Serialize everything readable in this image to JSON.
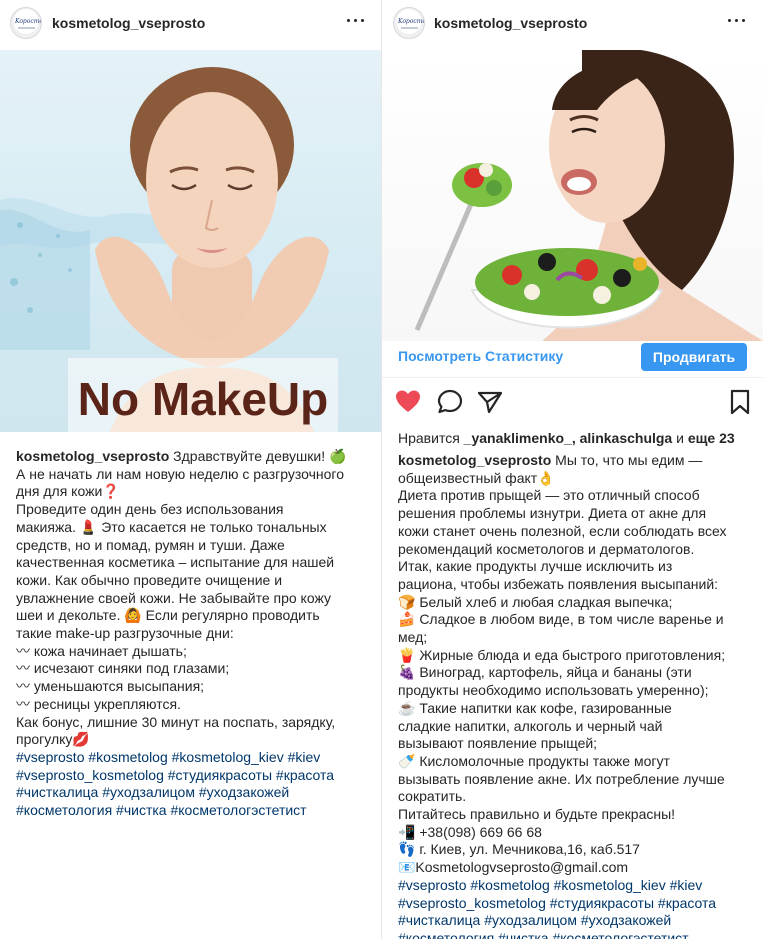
{
  "colors": {
    "link": "#3897f0",
    "hashtag": "#00376b",
    "heart": "#ed4956",
    "text": "#262626"
  },
  "left_post": {
    "username": "kosmetolog_vseprosto",
    "avatar_text": "Koросто",
    "image_overlay_text": "No MakeUp",
    "caption": {
      "intro": "Здравствуйте девушки! 🍏",
      "lines": [
        "А не начать ли нам новую неделю с разгрузочного",
        "дня для кожи❓",
        "Проведите один день без использования",
        "макияжа. 💄 Это касается не только тональных",
        "средств, но и помад, румян и туши. Даже",
        "качественная косметика – испытание для нашей",
        "кожи. Как обычно проведите очищение и",
        "увлажнение своей кожи. Не забывайте про кожу",
        "шеи и декольте. 🙆 Если регулярно проводить",
        "такие make-up разгрузочные дни:",
        "〰 кожа начинает дышать;",
        "〰 исчезают синяки под глазами;",
        "〰 уменьшаются высыпания;",
        "〰 ресницы укрепляются.",
        "Как бонус, лишние 30 минут на поспать, зарядку,",
        "прогулку💋"
      ],
      "hashtag_lines": [
        "#vseprosto #kosmetolog #kosmetolog_kiev #kiev",
        "#vseprosto_kosmetolog #студиякрасоты #красота",
        "#чисткалица #уходзалицом #уходзакожей",
        "#косметология #чистка #косметологэстетист"
      ]
    }
  },
  "right_post": {
    "username": "kosmetolog_vseprosto",
    "avatar_text": "Koросто",
    "stats_link": "Посмотреть Статистику",
    "promote_button": "Продвигать",
    "likes": {
      "prefix": "Нравится ",
      "user1": "_yanaklimenko_",
      "sep": ", ",
      "user2": "alinkaschulga",
      "mid": " и ",
      "others": "еще 23"
    },
    "caption": {
      "intro": "Мы то, что мы едим —",
      "lines": [
        "общеизвестный факт👌",
        "Диета против прыщей — это отличный способ",
        "решения проблемы изнутри. Диета от акне для",
        "кожи станет очень полезной, если соблюдать всех",
        "рекомендаций косметологов и дерматологов.",
        "Итак, какие продукты лучше исключить из",
        "рациона, чтобы избежать появления высыпаний:",
        "🍞 Белый хлеб и любая сладкая выпечка;",
        "🍰 Сладкое в любом виде, в том числе варенье и",
        "мед;",
        "🍟 Жирные блюда и еда быстрого приготовления;",
        "🍇 Виноград, картофель, яйца и бананы (эти",
        "продукты необходимо использовать умеренно);",
        "☕ Такие напитки как кофе, газированные",
        "сладкие напитки, алкоголь и черный чай",
        "вызывают появление прыщей;",
        "🍼 Кисломолочные продукты также могут",
        "вызывать появление акне. Их потребление лучше",
        "сократить.",
        "Питайтесь правильно и будьте прекрасны!",
        "📲 +38(098) 669 66 68",
        "👣 г. Киев, ул. Мечникова,16, каб.517",
        "📧Kosmetologvseprosto@gmail.com"
      ],
      "hashtag_lines": [
        "#vseprosto #kosmetolog #kosmetolog_kiev #kiev",
        "#vseprosto_kosmetolog #студиякрасоты #красота",
        "#чисткалица #уходзалицом #уходзакожей",
        "#косметология #чистка #косметологэстетист"
      ]
    }
  }
}
